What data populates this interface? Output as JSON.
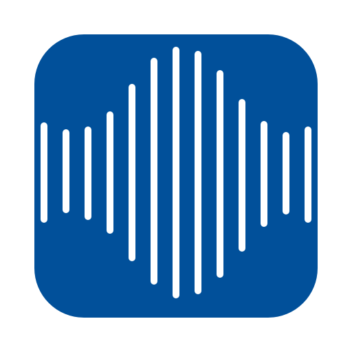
{
  "icon": {
    "name": "soundwave-icon",
    "background_color": "#01509A",
    "bar_color": "#FFFFFF"
  }
}
